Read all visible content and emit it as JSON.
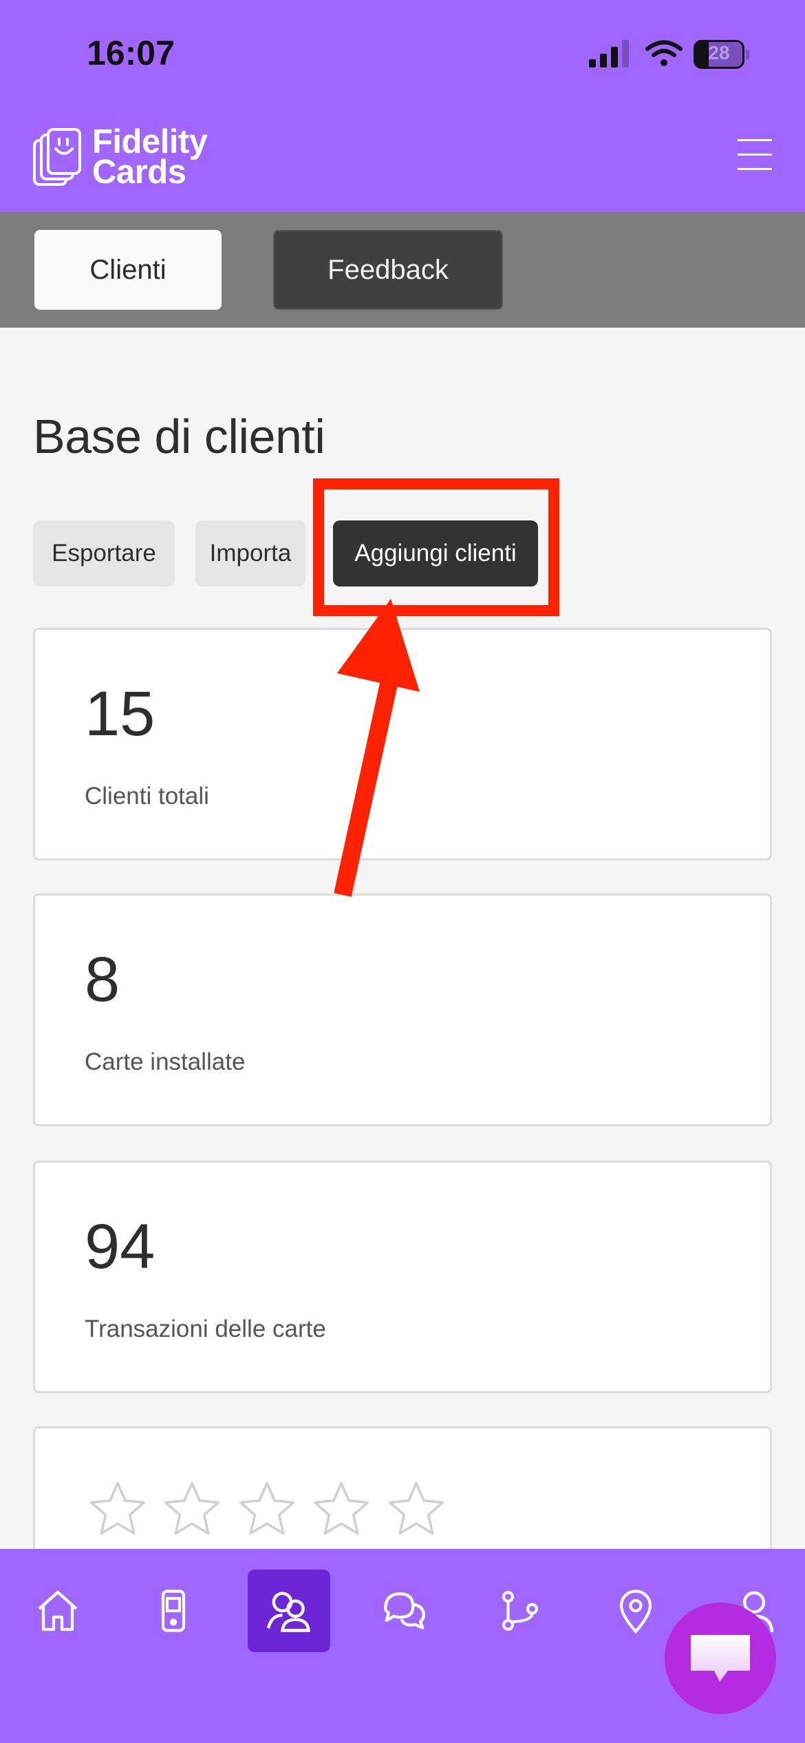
{
  "status_bar": {
    "time": "16:07",
    "battery": "28",
    "icons": [
      "signal-icon",
      "wifi-icon",
      "battery-icon"
    ]
  },
  "header": {
    "logo_line1": "Fidelity",
    "logo_line2": "Cards",
    "menu_icon": "hamburger-menu-icon"
  },
  "tabs": [
    {
      "label": "Clienti",
      "active": true
    },
    {
      "label": "Feedback",
      "active": false
    }
  ],
  "main": {
    "title": "Base di clienti",
    "actions": {
      "export_label": "Esportare",
      "import_label": "Importa",
      "add_label": "Aggiungi clienti"
    },
    "stats": [
      {
        "value": "15",
        "label": "Clienti totali"
      },
      {
        "value": "8",
        "label": "Carte installate"
      },
      {
        "value": "94",
        "label": "Transazioni delle carte"
      }
    ],
    "rating": {
      "stars_filled": 0,
      "stars_total": 5
    }
  },
  "bottom_nav": {
    "items": [
      "home-icon",
      "device-icon",
      "customers-icon",
      "chat-icon",
      "flow-icon",
      "location-icon",
      "profile-icon"
    ],
    "active_index": 2
  },
  "annotation": {
    "color": "#ff2200"
  },
  "colors": {
    "brand_purple": "#a066fd",
    "active_nav": "#6d26d6",
    "fab": "#b52be0",
    "dark_button": "#333333"
  }
}
